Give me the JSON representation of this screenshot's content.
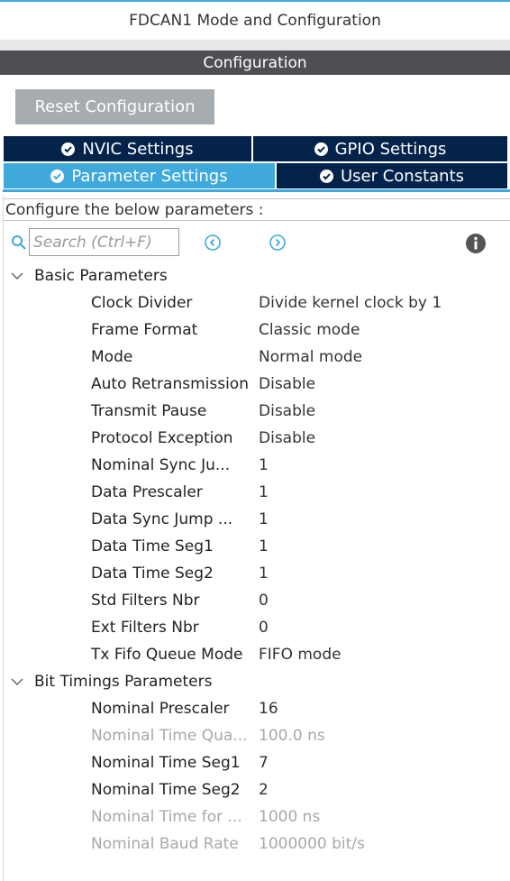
{
  "header": {
    "title": "FDCAN1 Mode and Configuration",
    "configuration_label": "Configuration"
  },
  "toolbar": {
    "reset_label": "Reset Configuration"
  },
  "tabs": [
    {
      "label": "NVIC Settings",
      "active": false
    },
    {
      "label": "GPIO Settings",
      "active": false
    },
    {
      "label": "Parameter Settings",
      "active": true
    },
    {
      "label": "User Constants",
      "active": false
    }
  ],
  "panel": {
    "configure_text": "Configure the below parameters :",
    "search_placeholder": "Search (Ctrl+F)"
  },
  "sections": [
    {
      "title": "Basic Parameters",
      "rows": [
        {
          "name": "Clock Divider",
          "value": "Divide kernel clock by 1",
          "enabled": true
        },
        {
          "name": "Frame Format",
          "value": "Classic mode",
          "enabled": true
        },
        {
          "name": "Mode",
          "value": "Normal mode",
          "enabled": true
        },
        {
          "name": "Auto Retransmission",
          "value": "Disable",
          "enabled": true
        },
        {
          "name": "Transmit Pause",
          "value": "Disable",
          "enabled": true
        },
        {
          "name": "Protocol Exception",
          "value": "Disable",
          "enabled": true
        },
        {
          "name": "Nominal Sync Ju...",
          "value": "1",
          "enabled": true
        },
        {
          "name": "Data Prescaler",
          "value": "1",
          "enabled": true
        },
        {
          "name": "Data Sync Jump ...",
          "value": "1",
          "enabled": true
        },
        {
          "name": "Data Time Seg1",
          "value": "1",
          "enabled": true
        },
        {
          "name": "Data Time Seg2",
          "value": "1",
          "enabled": true
        },
        {
          "name": "Std Filters Nbr",
          "value": "0",
          "enabled": true
        },
        {
          "name": "Ext Filters Nbr",
          "value": "0",
          "enabled": true
        },
        {
          "name": "Tx Fifo Queue Mode",
          "value": "FIFO mode",
          "enabled": true
        }
      ]
    },
    {
      "title": "Bit Timings Parameters",
      "rows": [
        {
          "name": "Nominal Prescaler",
          "value": "16",
          "enabled": true
        },
        {
          "name": "Nominal Time Qua...",
          "value": "100.0 ns",
          "enabled": false
        },
        {
          "name": "Nominal Time Seg1",
          "value": "7",
          "enabled": true
        },
        {
          "name": "Nominal Time Seg2",
          "value": "2",
          "enabled": true
        },
        {
          "name": "Nominal Time for ...",
          "value": "1000 ns",
          "enabled": false
        },
        {
          "name": "Nominal Baud Rate",
          "value": "1000000 bit/s",
          "enabled": false
        }
      ]
    }
  ],
  "colors": {
    "accent": "#3fa9dc",
    "tab_dark": "#03234b",
    "config_bar": "#4d4f53",
    "reset_button": "#a7acb0",
    "disabled_text": "#a8a8a8"
  }
}
